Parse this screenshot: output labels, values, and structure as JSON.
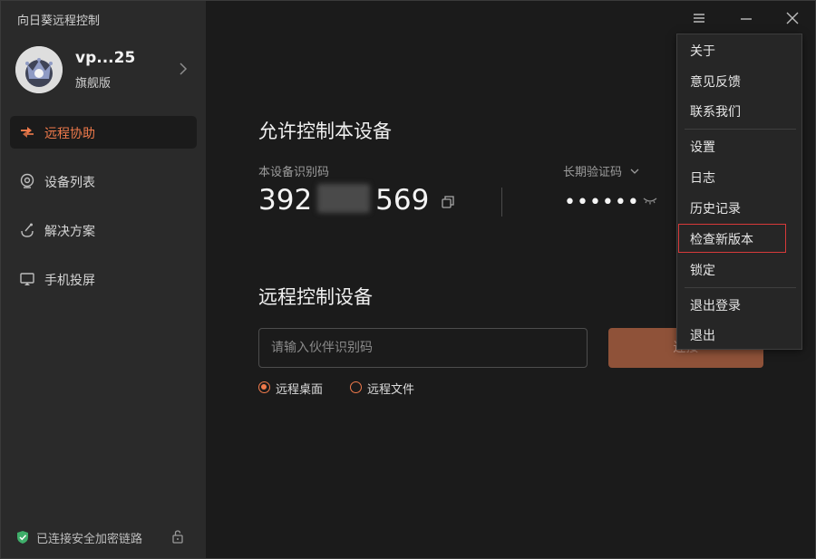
{
  "app": {
    "title": "向日葵远程控制"
  },
  "profile": {
    "name": "vp...25",
    "plan": "旗舰版"
  },
  "nav": [
    {
      "label": "远程协助",
      "icon": "remote-assist-icon",
      "active": true
    },
    {
      "label": "设备列表",
      "icon": "device-list-icon",
      "active": false
    },
    {
      "label": "解决方案",
      "icon": "solution-icon",
      "active": false
    },
    {
      "label": "手机投屏",
      "icon": "screen-cast-icon",
      "active": false
    }
  ],
  "status": {
    "secure_text": "已连接安全加密链路"
  },
  "allow": {
    "title": "允许控制本设备",
    "id_label": "本设备识别码",
    "id_prefix": "392",
    "id_suffix": "569",
    "code_label": "长期验证码",
    "code_mask": "••••••"
  },
  "remote": {
    "title": "远程控制设备",
    "placeholder": "请输入伙伴识别码",
    "connect_label": "连接",
    "options": [
      {
        "label": "远程桌面",
        "selected": true
      },
      {
        "label": "远程文件",
        "selected": false
      }
    ]
  },
  "menu": {
    "items": [
      "关于",
      "意见反馈",
      "联系我们",
      "设置",
      "日志",
      "历史记录",
      "检查新版本",
      "锁定",
      "退出登录",
      "退出"
    ]
  },
  "colors": {
    "accent": "#f07a4b",
    "sidebar_bg": "#2a2a2a",
    "main_bg": "#1b1b1b",
    "connect_bg": "#8f5239"
  }
}
